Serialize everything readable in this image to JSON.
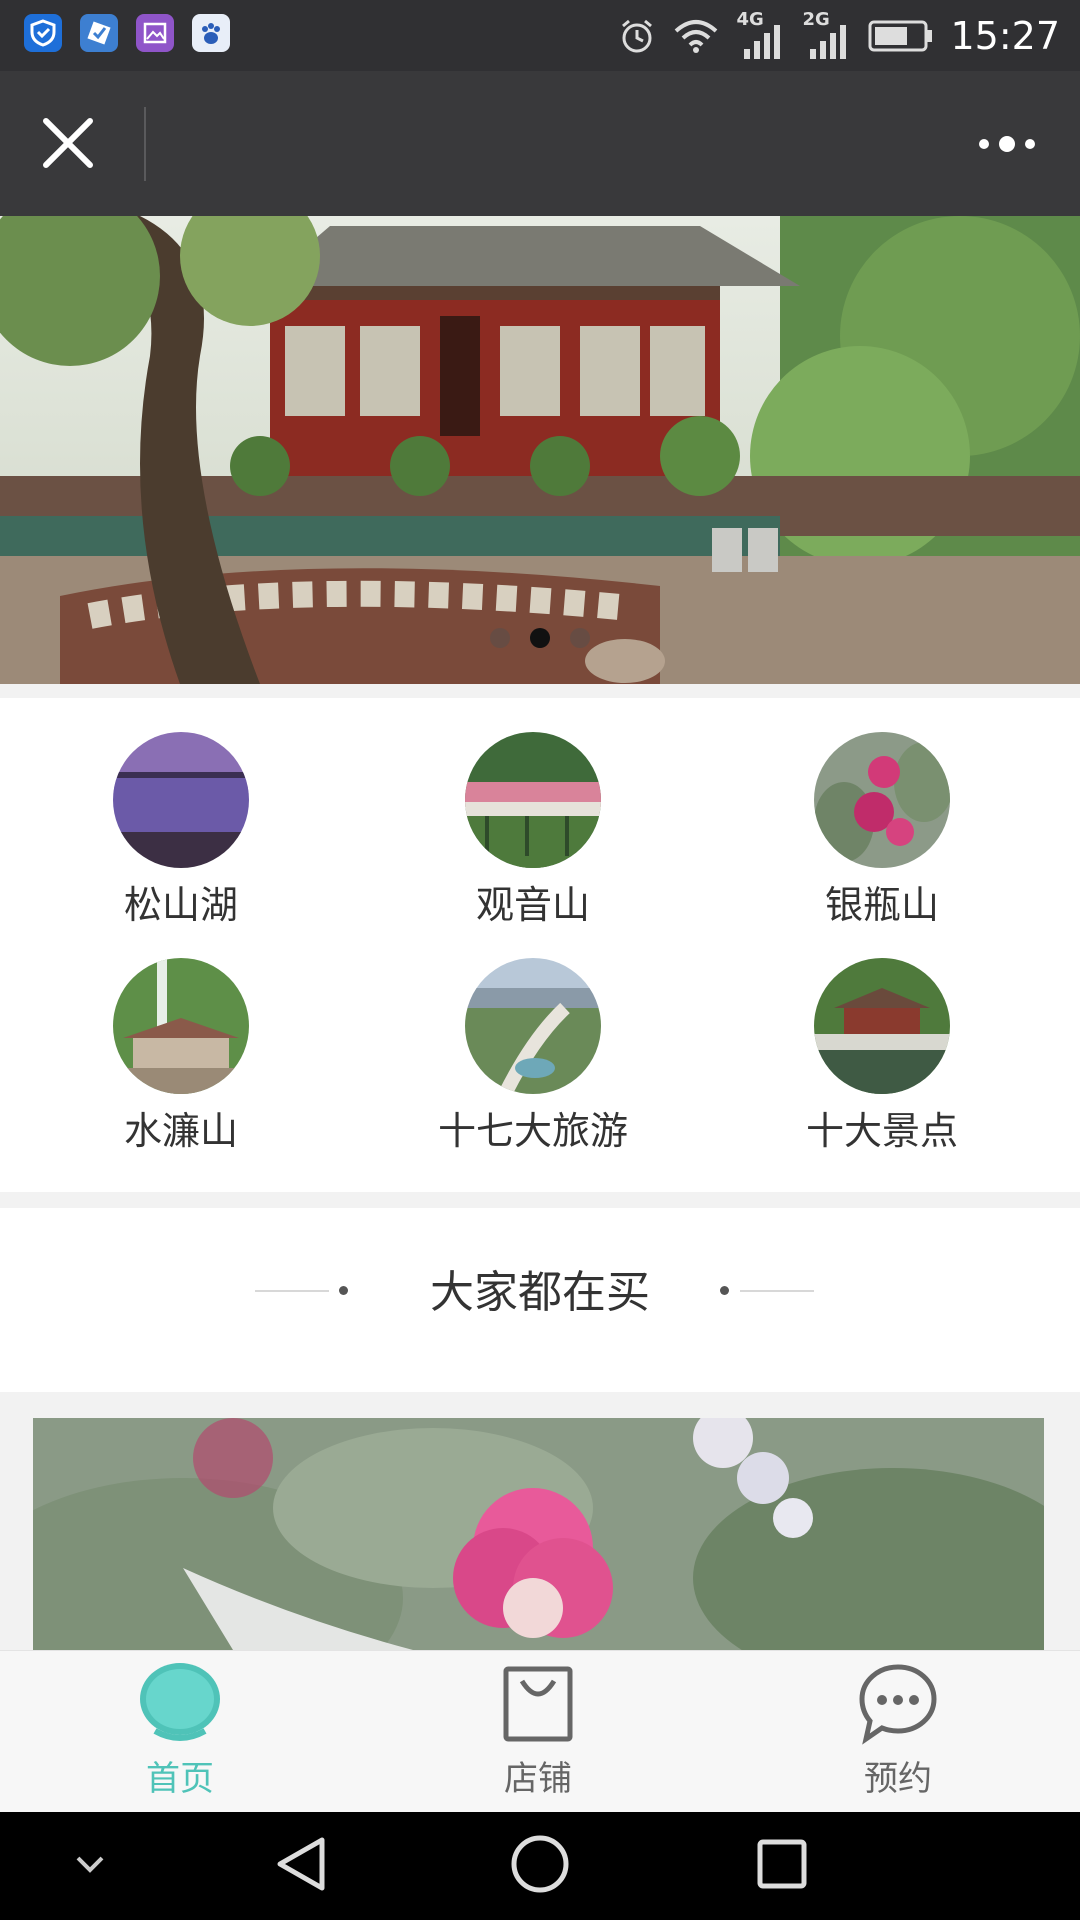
{
  "status_bar": {
    "time": "15:27",
    "network_1": "4G",
    "network_2": "2G",
    "icons": [
      "shield-app-icon",
      "checklist-app-icon",
      "gallery-app-icon",
      "baidu-app-icon",
      "alarm-icon",
      "wifi-icon",
      "signal-icon",
      "battery-icon"
    ]
  },
  "title_bar": {
    "close_icon": "close-icon",
    "more_icon": "more-dots-icon"
  },
  "banner": {
    "slide_count": 3,
    "active_index": 1
  },
  "categories": [
    {
      "label": "松山湖",
      "icon": "lake-thumb"
    },
    {
      "label": "观音山",
      "icon": "mountain-walkway-thumb"
    },
    {
      "label": "银瓶山",
      "icon": "flower-thumb"
    },
    {
      "label": "水濂山",
      "icon": "waterfall-temple-thumb"
    },
    {
      "label": "十七大旅游",
      "icon": "city-park-thumb"
    },
    {
      "label": "十大景点",
      "icon": "pavilion-thumb"
    }
  ],
  "section": {
    "title": "大家都在买"
  },
  "tabs": [
    {
      "label": "首页",
      "icon": "home-icon",
      "active": true
    },
    {
      "label": "店铺",
      "icon": "shop-bag-icon",
      "active": false
    },
    {
      "label": "预约",
      "icon": "chat-bubble-icon",
      "active": false
    }
  ],
  "colors": {
    "accent": "#4fc3b8",
    "inactive": "#666666",
    "titlebar": "#39393b",
    "statusbar": "#303033"
  }
}
